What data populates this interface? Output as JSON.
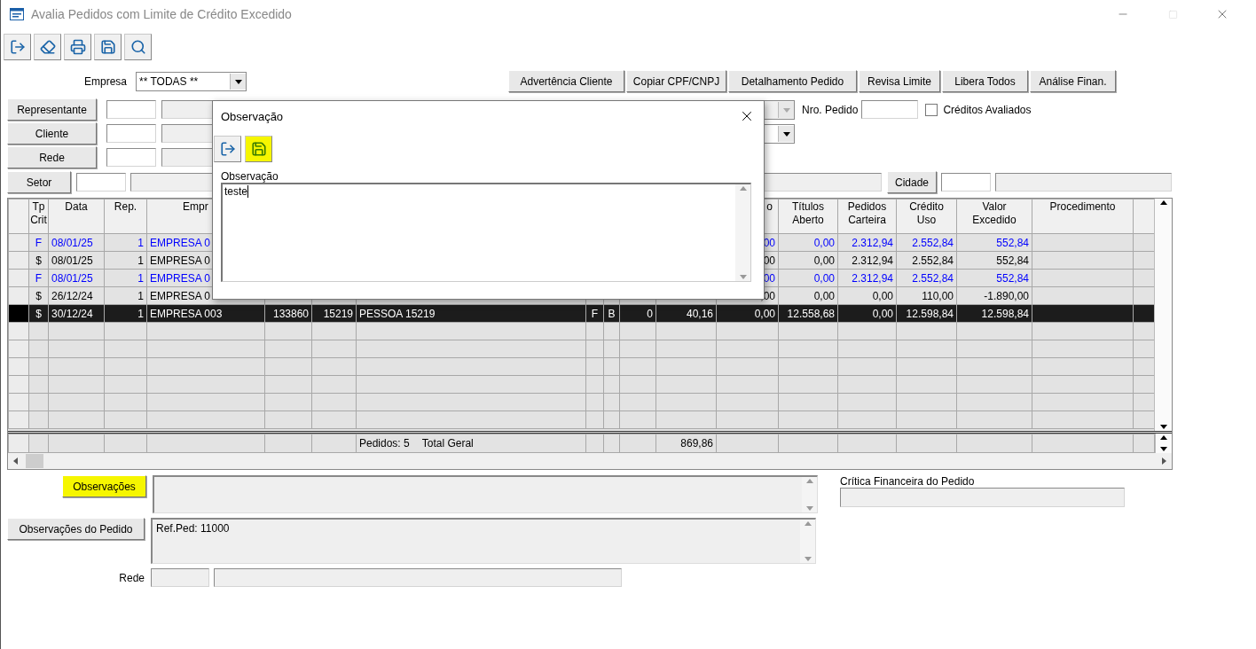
{
  "window": {
    "title": "Avalia Pedidos com Limite de Crédito Excedido"
  },
  "toolbar": [
    {
      "kind": "exit"
    },
    {
      "kind": "eraser"
    },
    {
      "kind": "print"
    },
    {
      "kind": "save"
    },
    {
      "kind": "search"
    }
  ],
  "empresa": {
    "label": "Empresa",
    "value": "** TODAS **"
  },
  "action_buttons": [
    "Advertência Cliente",
    "Copiar CPF/CNPJ",
    "Detalhamento Pedido",
    "Revisa Limite",
    "Libera Todos",
    "Análise Finan."
  ],
  "filters": [
    {
      "label": "Representante",
      "combo": {
        "disabled": true
      }
    },
    {
      "label": "Cliente",
      "combo": {
        "disabled": false
      }
    },
    {
      "label": "Rede"
    }
  ],
  "nro_pedido": {
    "label": "Nro. Pedido"
  },
  "creditos_avaliados": {
    "label": "Créditos Avaliados",
    "checked": false
  },
  "setor": {
    "label": "Setor"
  },
  "cidade": {
    "label": "Cidade"
  },
  "grid": {
    "columns": [
      "Tp\nCrit",
      "Data",
      "Rep.",
      "Empr",
      null,
      null,
      null,
      null,
      null,
      null,
      null,
      "o",
      "Títulos\nAberto",
      "Pedidos\nCarteira",
      "Crédito\nUso",
      "Valor\nExcedido",
      "Procedimento",
      null
    ],
    "rows": [
      {
        "selected": false,
        "color": "#0000ff",
        "cells": [
          "F",
          "08/01/25",
          "1",
          "EMPRESA 0",
          null,
          null,
          null,
          null,
          null,
          null,
          null,
          "00",
          "0,00",
          "2.312,94",
          "2.552,84",
          "552,84",
          null,
          null
        ]
      },
      {
        "selected": false,
        "color": "#000000",
        "cells": [
          "$",
          "08/01/25",
          "1",
          "EMPRESA 0",
          null,
          null,
          null,
          null,
          null,
          null,
          null,
          "00",
          "0,00",
          "2.312,94",
          "2.552,84",
          "552,84",
          null,
          null
        ]
      },
      {
        "selected": false,
        "color": "#0000ff",
        "cells": [
          "F",
          "08/01/25",
          "1",
          "EMPRESA 0",
          null,
          null,
          null,
          null,
          null,
          null,
          null,
          "00",
          "0,00",
          "2.312,94",
          "2.552,84",
          "552,84",
          null,
          null
        ]
      },
      {
        "selected": false,
        "color": "#000000",
        "cells": [
          "$",
          "26/12/24",
          "1",
          "EMPRESA 0",
          null,
          null,
          null,
          null,
          null,
          null,
          null,
          ",00",
          "0,00",
          "0,00",
          "110,00",
          "-1.890,00",
          null,
          null
        ]
      },
      {
        "selected": true,
        "color": "#000000",
        "cells": [
          "$",
          "30/12/24",
          "1",
          "EMPRESA 003",
          "133860",
          "15219",
          "PESSOA 15219",
          "F",
          "B",
          "0",
          "40,16",
          "0,00",
          "12.558,68",
          "0,00",
          "12.598,84",
          "12.598,84",
          null,
          null
        ]
      }
    ],
    "footer": {
      "count": "Pedidos: 5",
      "label": "Total Geral",
      "total": "869,86"
    }
  },
  "observacoes": {
    "label": "Observações",
    "highlighted": true
  },
  "observacoes_pedido": {
    "label": "Observações do Pedido",
    "value": "Ref.Ped: 11000"
  },
  "critica": {
    "label": "Crítica Financeira do Pedido"
  },
  "rede_bottom": {
    "label": "Rede"
  },
  "dialog": {
    "title": "Observação",
    "toolbar": [
      {
        "kind": "exit",
        "highlighted": false
      },
      {
        "kind": "save",
        "highlighted": true
      }
    ],
    "field_label": "Observação",
    "value": "teste"
  }
}
